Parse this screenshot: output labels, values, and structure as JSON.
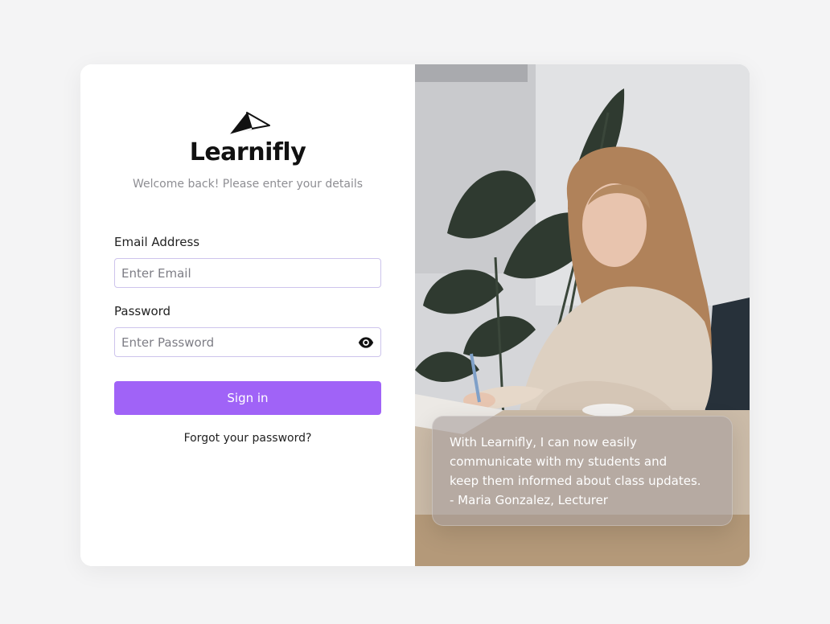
{
  "brand": {
    "name": "Learnifly",
    "logo_icon": "paper-plane-icon",
    "tagline": "Welcome back! Please enter your details"
  },
  "form": {
    "email_label": "Email Address",
    "email_placeholder": "Enter Email",
    "email_value": "",
    "password_label": "Password",
    "password_placeholder": "Enter Password",
    "password_value": "",
    "password_toggle_icon": "eye-icon",
    "submit_label": "Sign in",
    "forgot_label": "Forgot your password?"
  },
  "testimonial": {
    "lines": [
      "With Learnifly, I can now easily",
      "communicate with my students and",
      "keep them informed about class updates.",
      "- Maria Gonzalez, Lecturer"
    ]
  },
  "colors": {
    "accent": "#a063f7",
    "background": "#f4f4f5",
    "input_border": "#cdc4ec",
    "muted_text": "#8e8e93"
  }
}
